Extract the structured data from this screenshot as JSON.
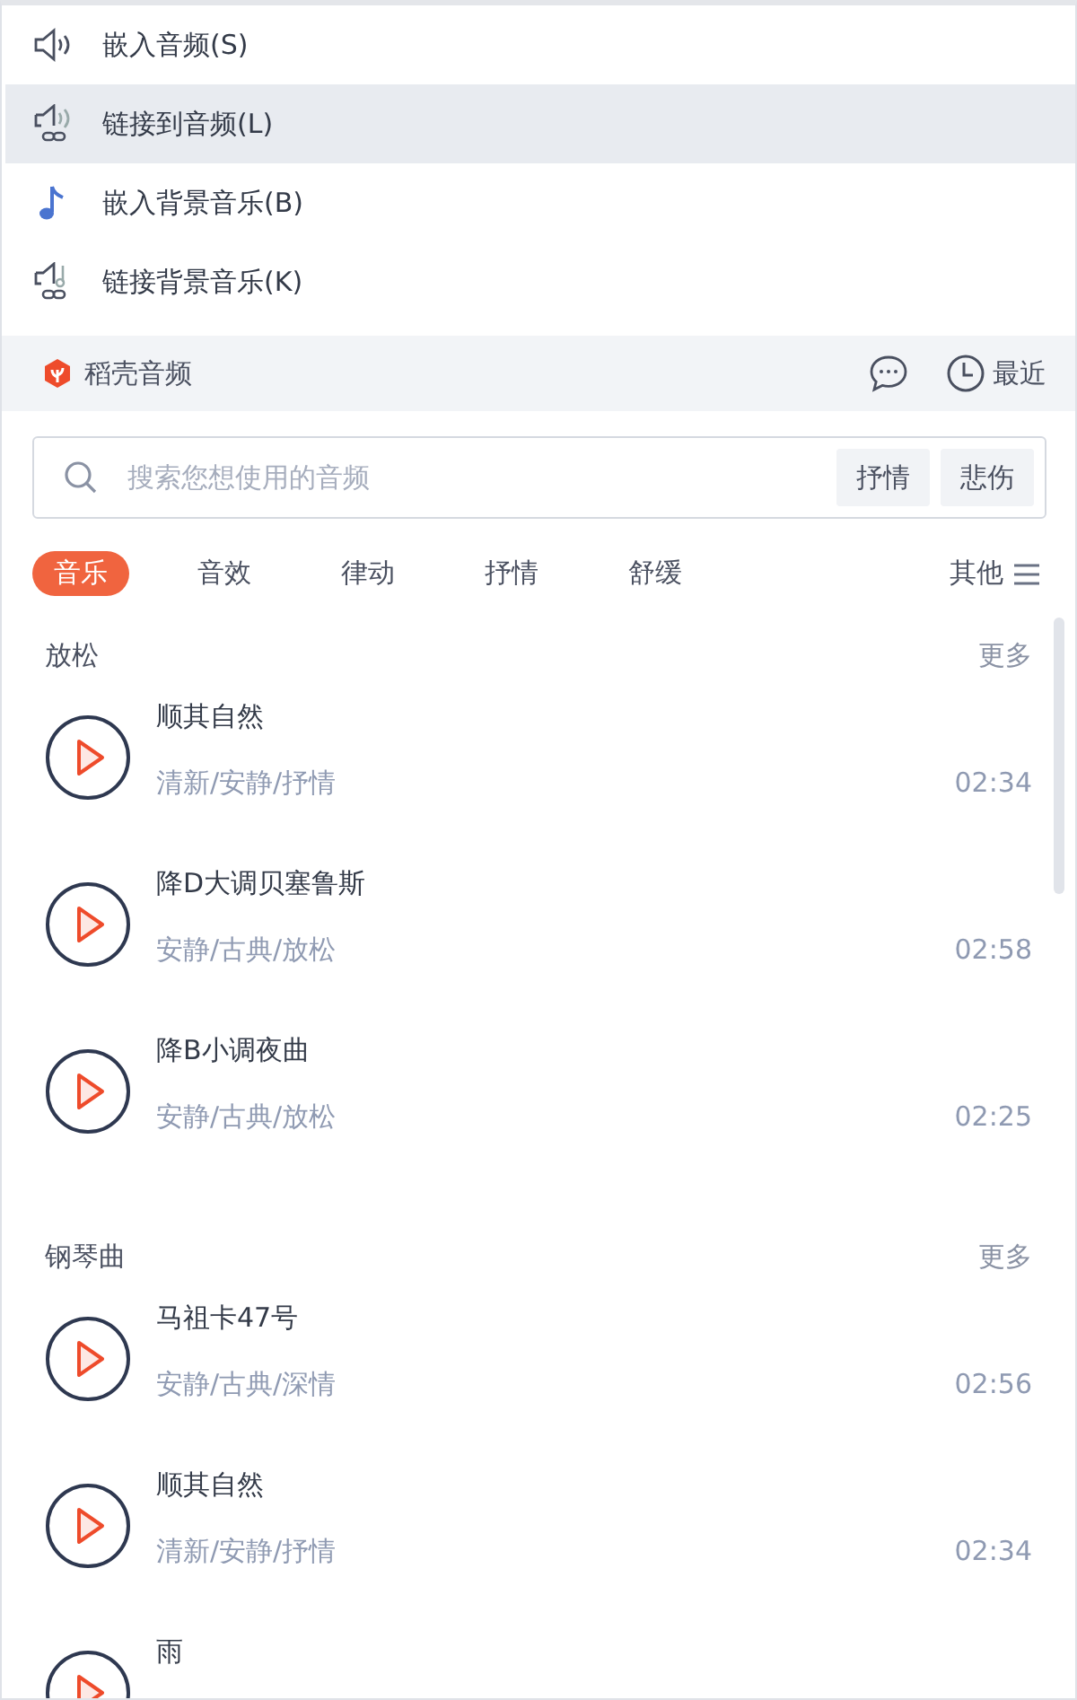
{
  "menu": [
    {
      "kind": "embed-audio",
      "label": "嵌入音频(S)",
      "selected": false
    },
    {
      "kind": "link-audio",
      "label": "链接到音频(L)",
      "selected": true
    },
    {
      "kind": "embed-music",
      "label": "嵌入背景音乐(B)",
      "selected": false
    },
    {
      "kind": "link-music",
      "label": "链接背景音乐(K)",
      "selected": false
    }
  ],
  "header": {
    "brand": "稻壳音频",
    "recent": "最近"
  },
  "search": {
    "placeholder": "搜索您想使用的音频",
    "tags": [
      "抒情",
      "悲伤"
    ]
  },
  "tabs": [
    {
      "label": "音乐",
      "selected": true
    },
    {
      "label": "音效",
      "selected": false
    },
    {
      "label": "律动",
      "selected": false
    },
    {
      "label": "抒情",
      "selected": false
    },
    {
      "label": "舒缓",
      "selected": false
    }
  ],
  "other": "其他",
  "sections": [
    {
      "name": "放松",
      "more": "更多",
      "tracks": [
        {
          "title": "顺其自然",
          "tags": "清新/安静/抒情",
          "duration": "02:34"
        },
        {
          "title": "降D大调贝塞鲁斯",
          "tags": "安静/古典/放松",
          "duration": "02:58"
        },
        {
          "title": "降B小调夜曲",
          "tags": "安静/古典/放松",
          "duration": "02:25"
        }
      ]
    },
    {
      "name": "钢琴曲",
      "more": "更多",
      "tracks": [
        {
          "title": "马祖卡47号",
          "tags": "安静/古典/深情",
          "duration": "02:56"
        },
        {
          "title": "顺其自然",
          "tags": "清新/安静/抒情",
          "duration": "02:34"
        },
        {
          "title": "雨"
        }
      ]
    }
  ]
}
